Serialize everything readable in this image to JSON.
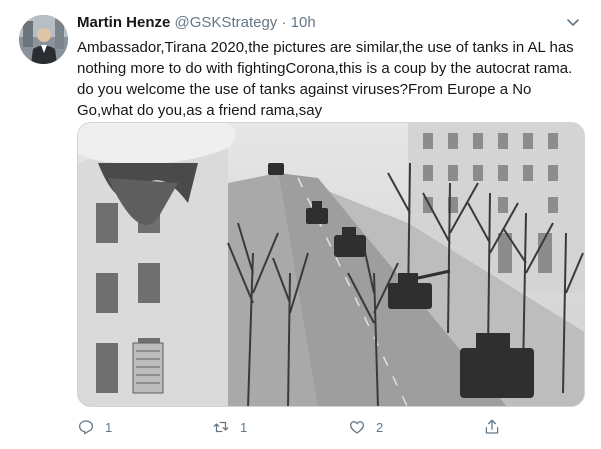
{
  "tweet": {
    "author_name": "Martin Henze",
    "handle": "@GSKStrategy",
    "separator": "·",
    "time": "10h",
    "text": "Ambassador,Tirana 2020,the pictures are similar,the use of tanks in AL has nothing more to do with fightingCorona,this is a coup by the autocrat rama. do you welcome the use of tanks against viruses?From Europe a No Go,what do you,as a friend rama,say",
    "avatar_icon": "avatar-photo",
    "menu_icon": "chevron-down-icon",
    "media": {
      "icon": "photo-street-tanks",
      "tone": "grayscale"
    },
    "actions": {
      "reply_count": "1",
      "retweet_count": "1",
      "like_count": "2",
      "share_count": ""
    }
  },
  "colors": {
    "text": "#14171a",
    "secondary": "#657786",
    "border": "#ccd6dd"
  }
}
